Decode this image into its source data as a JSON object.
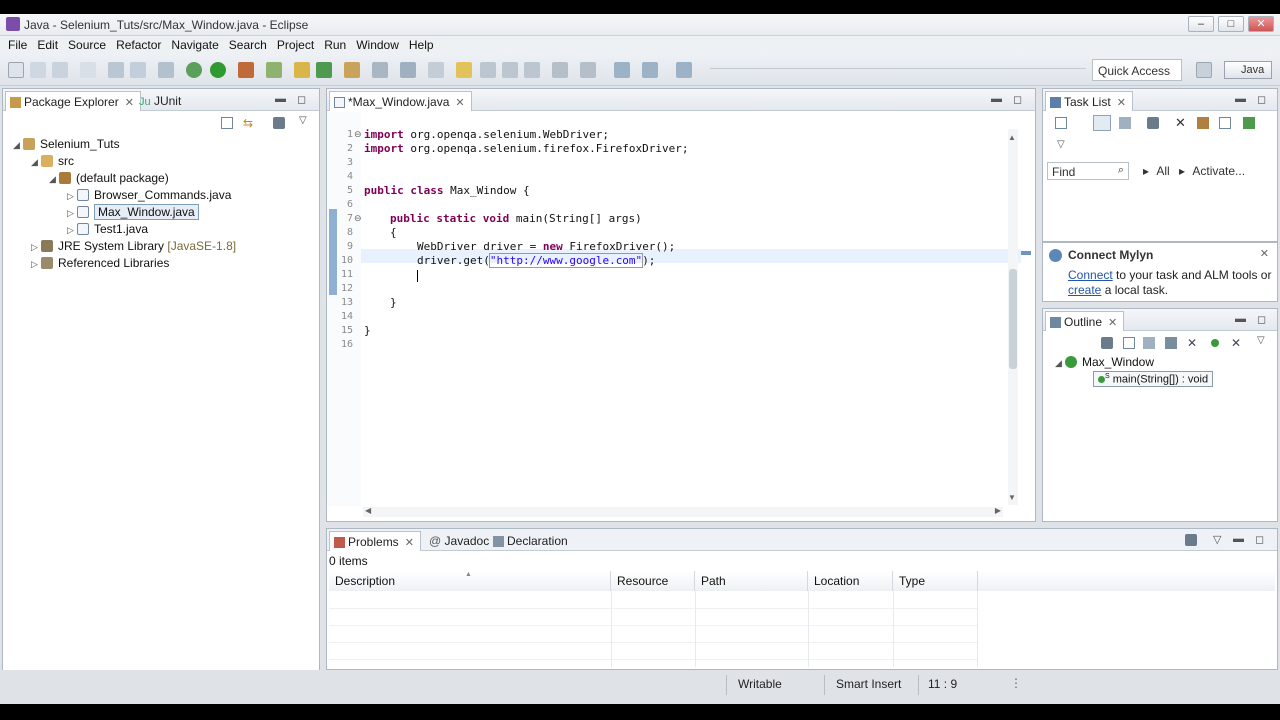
{
  "window": {
    "title": "Java - Selenium_Tuts/src/Max_Window.java - Eclipse",
    "min": "–",
    "max": "□",
    "close": "✕"
  },
  "menu": [
    "File",
    "Edit",
    "Source",
    "Refactor",
    "Navigate",
    "Search",
    "Project",
    "Run",
    "Window",
    "Help"
  ],
  "toolbar": {
    "quick_access": "Quick Access",
    "perspective": "Java"
  },
  "left_panel": {
    "tabs": [
      {
        "label": "Package Explorer"
      },
      {
        "label": "JUnit",
        "prefix": "Ju"
      }
    ],
    "tree": {
      "project": "Selenium_Tuts",
      "src": "src",
      "package": "(default package)",
      "files": [
        "Browser_Commands.java",
        "Max_Window.java",
        "Test1.java"
      ],
      "jre": "JRE System Library",
      "jre_version": "[JavaSE-1.8]",
      "ref_libs": "Referenced Libraries"
    }
  },
  "editor": {
    "tab": "*Max_Window.java",
    "line_numbers": [
      "1",
      "2",
      "3",
      "4",
      "5",
      "6",
      "7",
      "8",
      "9",
      "10",
      "11",
      "12",
      "13",
      "14",
      "15",
      "16"
    ],
    "lines": {
      "l1": {
        "kw": "import",
        "rest": " org.openqa.selenium.WebDriver;"
      },
      "l2": {
        "kw": "import",
        "rest": " org.openqa.selenium.firefox.FirefoxDriver;"
      },
      "l4": {
        "kw1": "public",
        "kw2": "class",
        "rest": " Max_Window {"
      },
      "l7": {
        "kw1": "public",
        "kw2": "static",
        "kw3": "void",
        "rest": " main(String[] args)"
      },
      "l8": "{",
      "l9": {
        "pre": "WebDriver driver = ",
        "kw": "new",
        "post": " FirefoxDriver();"
      },
      "l10": {
        "pre": "driver.get(",
        "str": "\"http://www.google.com\"",
        "post": ");"
      },
      "l13": "}",
      "l15": "}"
    }
  },
  "task_list": {
    "tab": "Task List",
    "find_placeholder": "Find",
    "all": "All",
    "activate": "Activate..."
  },
  "mylyn": {
    "title": "Connect Mylyn",
    "connect": "Connect",
    "text1": " to your task and ALM tools or",
    "create": "create",
    "text2": " a local task."
  },
  "outline": {
    "tab": "Outline",
    "class_name": "Max_Window",
    "method": "main(String[]) : void",
    "method_super": "S"
  },
  "problems": {
    "tabs": [
      {
        "label": "Problems"
      },
      {
        "label": "Javadoc",
        "prefix": "@"
      },
      {
        "label": "Declaration"
      }
    ],
    "count": "0 items",
    "columns": [
      "Description",
      "Resource",
      "Path",
      "Location",
      "Type"
    ]
  },
  "statusbar": {
    "writable": "Writable",
    "insert_mode": "Smart Insert",
    "position": "11 : 9"
  }
}
